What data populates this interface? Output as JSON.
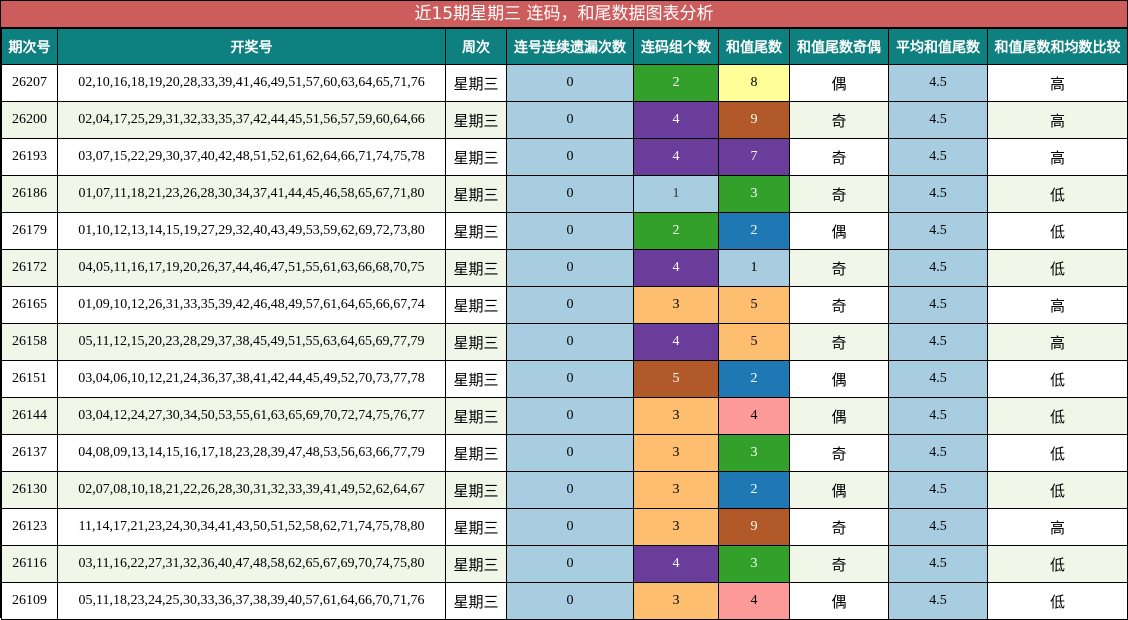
{
  "title": "近15期星期三 连码，和尾数据图表分析",
  "headers": [
    "期次号",
    "开奖号",
    "周次",
    "连号连续遗漏次数",
    "连码组个数",
    "和值尾数",
    "和值尾数奇偶",
    "平均和值尾数",
    "和值尾数和均数比较"
  ],
  "colors": {
    "title_bg": "#cd5c5c",
    "header_bg": "#0f8080",
    "miss_bg": "#a8cde0",
    "avg_bg": "#a8cde0",
    "group_colors": {
      "1": "#a8cde0",
      "2": "#33a02c",
      "3": "#fdbf6f",
      "4": "#6a3d9a",
      "5": "#b15928"
    },
    "tail_colors": {
      "1": "#a8cde0",
      "2": "#1f78b4",
      "3": "#33a02c",
      "4": "#fb9a99",
      "5": "#fdbf6f",
      "7": "#6a3d9a",
      "8": "#ffff99",
      "9": "#b15928"
    }
  },
  "rows": [
    {
      "period": "26207",
      "numbers": "02,10,16,18,19,20,28,33,39,41,46,49,51,57,60,63,64,65,71,76",
      "weekday": "星期三",
      "miss": "0",
      "groups": "2",
      "tail": "8",
      "parity": "偶",
      "avg": "4.5",
      "compare": "高"
    },
    {
      "period": "26200",
      "numbers": "02,04,17,25,29,31,32,33,35,37,42,44,45,51,56,57,59,60,64,66",
      "weekday": "星期三",
      "miss": "0",
      "groups": "4",
      "tail": "9",
      "parity": "奇",
      "avg": "4.5",
      "compare": "高"
    },
    {
      "period": "26193",
      "numbers": "03,07,15,22,29,30,37,40,42,48,51,52,61,62,64,66,71,74,75,78",
      "weekday": "星期三",
      "miss": "0",
      "groups": "4",
      "tail": "7",
      "parity": "奇",
      "avg": "4.5",
      "compare": "高"
    },
    {
      "period": "26186",
      "numbers": "01,07,11,18,21,23,26,28,30,34,37,41,44,45,46,58,65,67,71,80",
      "weekday": "星期三",
      "miss": "0",
      "groups": "1",
      "tail": "3",
      "parity": "奇",
      "avg": "4.5",
      "compare": "低"
    },
    {
      "period": "26179",
      "numbers": "01,10,12,13,14,15,19,27,29,32,40,43,49,53,59,62,69,72,73,80",
      "weekday": "星期三",
      "miss": "0",
      "groups": "2",
      "tail": "2",
      "parity": "偶",
      "avg": "4.5",
      "compare": "低"
    },
    {
      "period": "26172",
      "numbers": "04,05,11,16,17,19,20,26,37,44,46,47,51,55,61,63,66,68,70,75",
      "weekday": "星期三",
      "miss": "0",
      "groups": "4",
      "tail": "1",
      "parity": "奇",
      "avg": "4.5",
      "compare": "低"
    },
    {
      "period": "26165",
      "numbers": "01,09,10,12,26,31,33,35,39,42,46,48,49,57,61,64,65,66,67,74",
      "weekday": "星期三",
      "miss": "0",
      "groups": "3",
      "tail": "5",
      "parity": "奇",
      "avg": "4.5",
      "compare": "高"
    },
    {
      "period": "26158",
      "numbers": "05,11,12,15,20,23,28,29,37,38,45,49,51,55,63,64,65,69,77,79",
      "weekday": "星期三",
      "miss": "0",
      "groups": "4",
      "tail": "5",
      "parity": "奇",
      "avg": "4.5",
      "compare": "高"
    },
    {
      "period": "26151",
      "numbers": "03,04,06,10,12,21,24,36,37,38,41,42,44,45,49,52,70,73,77,78",
      "weekday": "星期三",
      "miss": "0",
      "groups": "5",
      "tail": "2",
      "parity": "偶",
      "avg": "4.5",
      "compare": "低"
    },
    {
      "period": "26144",
      "numbers": "03,04,12,24,27,30,34,50,53,55,61,63,65,69,70,72,74,75,76,77",
      "weekday": "星期三",
      "miss": "0",
      "groups": "3",
      "tail": "4",
      "parity": "偶",
      "avg": "4.5",
      "compare": "低"
    },
    {
      "period": "26137",
      "numbers": "04,08,09,13,14,15,16,17,18,23,28,39,47,48,53,56,63,66,77,79",
      "weekday": "星期三",
      "miss": "0",
      "groups": "3",
      "tail": "3",
      "parity": "奇",
      "avg": "4.5",
      "compare": "低"
    },
    {
      "period": "26130",
      "numbers": "02,07,08,10,18,21,22,26,28,30,31,32,33,39,41,49,52,62,64,67",
      "weekday": "星期三",
      "miss": "0",
      "groups": "3",
      "tail": "2",
      "parity": "偶",
      "avg": "4.5",
      "compare": "低"
    },
    {
      "period": "26123",
      "numbers": "11,14,17,21,23,24,30,34,41,43,50,51,52,58,62,71,74,75,78,80",
      "weekday": "星期三",
      "miss": "0",
      "groups": "3",
      "tail": "9",
      "parity": "奇",
      "avg": "4.5",
      "compare": "高"
    },
    {
      "period": "26116",
      "numbers": "03,11,16,22,27,31,32,36,40,47,48,58,62,65,67,69,70,74,75,80",
      "weekday": "星期三",
      "miss": "0",
      "groups": "4",
      "tail": "3",
      "parity": "奇",
      "avg": "4.5",
      "compare": "低"
    },
    {
      "period": "26109",
      "numbers": "05,11,18,23,24,25,30,33,36,37,38,39,40,57,61,64,66,70,71,76",
      "weekday": "星期三",
      "miss": "0",
      "groups": "3",
      "tail": "4",
      "parity": "偶",
      "avg": "4.5",
      "compare": "低"
    }
  ]
}
